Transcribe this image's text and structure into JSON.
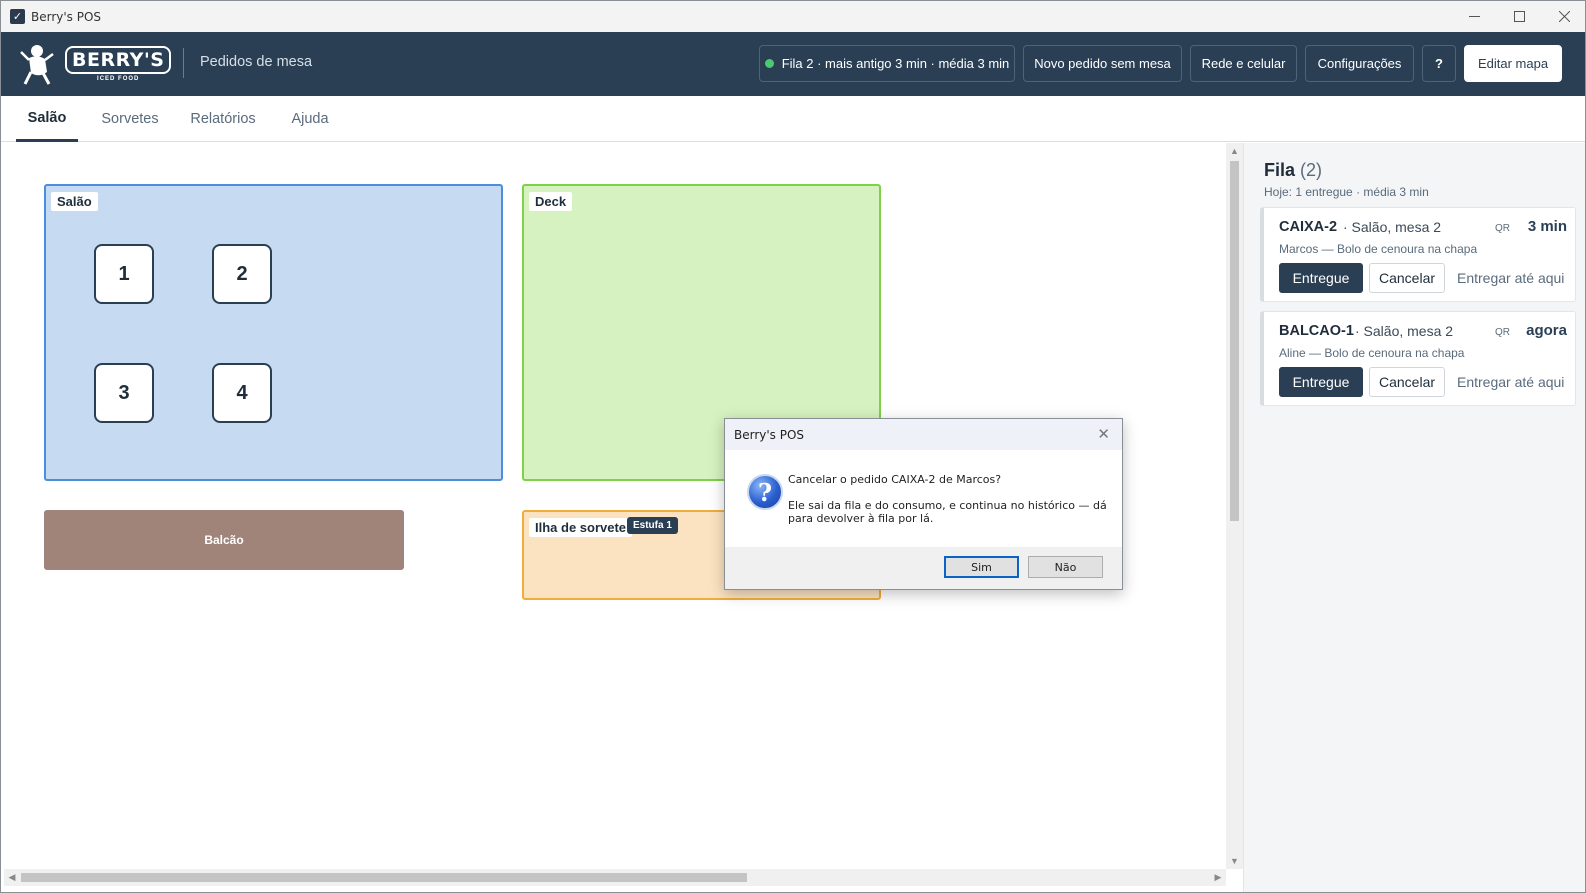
{
  "window": {
    "title": "Berry's POS",
    "minimize_icon": "minimize-icon",
    "maximize_icon": "maximize-icon",
    "close_icon": "close-icon"
  },
  "header": {
    "logo_text": "BERRY'S",
    "logo_subtext": "ICED FOOD",
    "subtitle": "Pedidos de mesa",
    "status_label": "Fila 2 · mais antigo 3 min · média 3 min",
    "status_color": "#4cc773",
    "new_order_label": "Novo pedido sem mesa",
    "network_label": "Rede e celular",
    "settings_label": "Configurações",
    "help_label": "?",
    "edit_map_label": "Editar mapa",
    "brand_color": "#2b3f54"
  },
  "tabs": [
    {
      "label": "Salão",
      "active": true
    },
    {
      "label": "Sorvetes",
      "active": false
    },
    {
      "label": "Relatórios",
      "active": false
    },
    {
      "label": "Ajuda",
      "active": false
    }
  ],
  "map": {
    "zones": {
      "salao": {
        "label": "Salão",
        "color": "#c6dbf2"
      },
      "deck": {
        "label": "Deck",
        "color": "#d6f2c0"
      },
      "balcao": {
        "label": "Balcão",
        "color": "#a0847a"
      },
      "ilha": {
        "label": "Ilha de sorvete",
        "badge": "Estufa 1",
        "color": "#fbe3c1"
      }
    },
    "tables": [
      "1",
      "2",
      "3",
      "4"
    ]
  },
  "queue": {
    "title": "Fila",
    "count": "(2)",
    "summary": "Hoje: 1 entregue · média 3 min",
    "orders": [
      {
        "code": "CAIXA-2",
        "place": "· Salão, mesa 2",
        "source": "QR",
        "time": "3 min",
        "details": "Marcos  —  Bolo de cenoura na chapa",
        "deliver_label": "Entregue",
        "cancel_label": "Cancelar",
        "deliver_until_label": "Entregar até aqui"
      },
      {
        "code": "BALCAO-1",
        "place": "· Salão, mesa 2",
        "source": "QR",
        "time": "agora",
        "details": "Aline  —  Bolo de cenoura na chapa",
        "deliver_label": "Entregue",
        "cancel_label": "Cancelar",
        "deliver_until_label": "Entregar até aqui"
      }
    ]
  },
  "dialog": {
    "title": "Berry's POS",
    "icon": "question-icon",
    "question": "Cancelar o pedido CAIXA-2 de Marcos?",
    "message": "Ele sai da fila e do consumo, e continua no histórico — dá para devolver à fila por lá.",
    "yes_label": "Sim",
    "no_label": "Não"
  }
}
